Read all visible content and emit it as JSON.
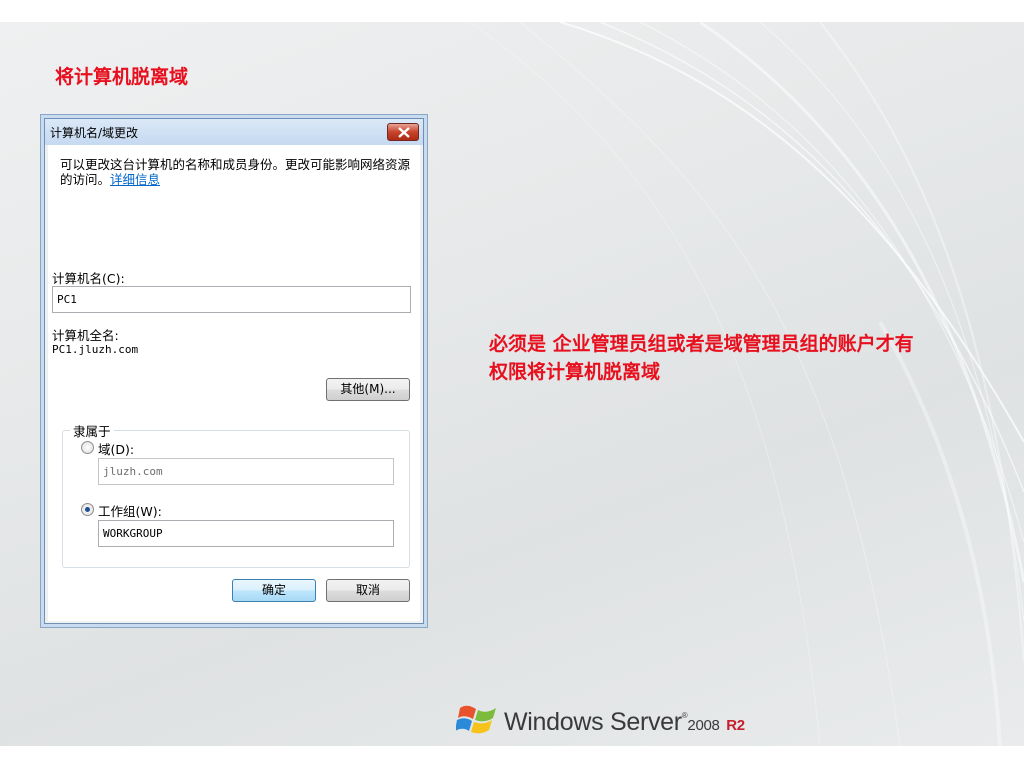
{
  "slide": {
    "title": "将计算机脱离域",
    "note": "必须是 企业管理员组或者是域管理员组的账户才有权限将计算机脱离域"
  },
  "dialog": {
    "title": "计算机名/域更改",
    "description": "可以更改这台计算机的名称和成员身份。更改可能影响网络资源的访问。",
    "details_link": "详细信息",
    "computer_name_label": "计算机名(C):",
    "computer_name_value": "PC1",
    "full_name_label": "计算机全名:",
    "full_name_value": "PC1.jluzh.com",
    "more_button": "其他(M)...",
    "member_of_label": "隶属于",
    "domain_label": "域(D):",
    "domain_value": "jluzh.com",
    "workgroup_label": "工作组(W):",
    "workgroup_value": "WORKGROUP",
    "selected_option": "workgroup",
    "ok_button": "确定",
    "cancel_button": "取消"
  },
  "branding": {
    "product": "Windows Server",
    "version": "2008",
    "release": "R2",
    "icon": "windows-flag-icon"
  },
  "colors": {
    "accent_red": "#e8101e",
    "link_blue": "#0066cc",
    "close_red": "#c7432b"
  }
}
